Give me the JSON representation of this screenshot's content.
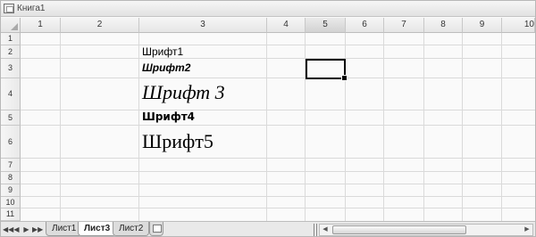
{
  "window": {
    "title": "Книга1"
  },
  "columns": [
    "1",
    "2",
    "3",
    "4",
    "5",
    "6",
    "7",
    "8",
    "9",
    "10"
  ],
  "selected_column": "5",
  "rows": [
    "1",
    "2",
    "3",
    "4",
    "5",
    "6",
    "7",
    "8",
    "9",
    "10",
    "11"
  ],
  "cells": {
    "r2": "Шрифт1",
    "r3": "Шрифт2",
    "r4": "Шрифт 3",
    "r5": "Шрифт4",
    "r6": "Шрифт5"
  },
  "sheet_tabs": [
    {
      "label": "Лист1",
      "active": false
    },
    {
      "label": "Лист3",
      "active": true
    },
    {
      "label": "Лист2",
      "active": false
    }
  ],
  "nav_buttons": [
    "◀◀",
    "◀",
    "▶",
    "▶▶"
  ],
  "scroll_arrows": {
    "left": "◀",
    "right": "▶"
  },
  "icons": [
    "workbook-icon",
    "select-all-triangle-icon",
    "insert-sheet-icon"
  ],
  "colors": {
    "selection_border": "#000000",
    "gridline": "#dadada",
    "header_bg": "#ececec",
    "active_tab": "#ffffff"
  }
}
